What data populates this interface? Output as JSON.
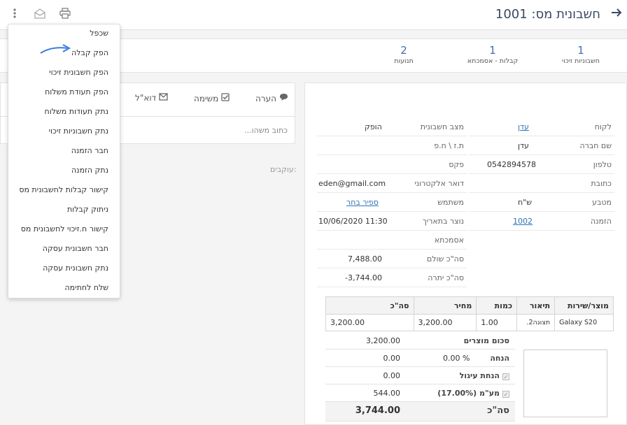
{
  "header": {
    "title": "חשבונית מס:",
    "number": "1001"
  },
  "stats": [
    {
      "count": "1",
      "label": "חשבוניות זיכוי"
    },
    {
      "count": "1",
      "label": "קבלות - אסמכתא"
    },
    {
      "count": "2",
      "label": "תנועות"
    }
  ],
  "activity": {
    "tabs": [
      "הערה",
      "משימה",
      "דוא\"ל"
    ],
    "placeholder": "כתוב משהו...",
    "followers_label": "עוקבים:"
  },
  "customer_fields": [
    {
      "label": "לקוח",
      "value": "עדן",
      "link": true
    },
    {
      "label": "שם חברה",
      "value": "עדן"
    },
    {
      "label": "טלפון",
      "value": "0542894578"
    },
    {
      "label": "כתובת",
      "value": ""
    },
    {
      "label": "מטבע",
      "value": "ש\"ח"
    },
    {
      "label": "הזמנה",
      "value": "1002",
      "link": true
    }
  ],
  "invoice_fields": [
    {
      "label": "מצב חשבונית",
      "value": "הופק"
    },
    {
      "label": "ת.ז \\ ח.פ",
      "value": ""
    },
    {
      "label": "פקס",
      "value": ""
    },
    {
      "label": "דואר אלקטרוני",
      "value": "eden@gmail.com"
    },
    {
      "label": "משתמש",
      "value": "ספיר בחר",
      "link": true
    },
    {
      "label": "נוצר בתאריך",
      "value": "10/06/2020 11:30"
    },
    {
      "label": "אסמכתא",
      "value": ""
    },
    {
      "label": "סה\"כ שולם",
      "value": "7,488.00"
    },
    {
      "label": "סה\"כ יתרה",
      "value": "-3,744.00"
    }
  ],
  "lines": {
    "headers": [
      "מוצר/שירות",
      "תיאור",
      "כמות",
      "מחיר",
      "סה\"כ"
    ],
    "rows": [
      [
        "Galaxy S20",
        "תצוגה2.",
        "1.00",
        "3,200.00",
        "3,200.00"
      ]
    ]
  },
  "summary": {
    "subtotal_label": "סכום מוצרים",
    "subtotal": "3,200.00",
    "discount_label": "הנחה",
    "discount_pct": "0.00",
    "discount_unit": "%",
    "discount": "0.00",
    "rounding_label": "הנחת עיגול",
    "rounding": "0.00",
    "vat_label": "מע\"מ (17.00%)",
    "vat": "544.00",
    "total_label": "סה\"כ",
    "total": "3,744.00"
  },
  "menu": [
    "שכפל",
    "הפק קבלה",
    "הפק חשבונית זיכוי",
    "הפק תעודת משלוח",
    "נתק תעודות משלוח",
    "נתק חשבוניות זיכוי",
    "חבר הזמנה",
    "נתק הזמנה",
    "קישור קבלות לחשבונית מס",
    "ניתוק קבלות",
    "קישור ח.זיכוי לחשבונית מס",
    "חבר חשבונית עסקה",
    "נתק חשבונית עסקה",
    "שלח לחתימה"
  ],
  "colors": {
    "accent": "#3e6fb4",
    "arrow": "#3b7be0",
    "title": "#3a4a63"
  },
  "icons": [
    "arrow-right-icon",
    "print-icon",
    "email-open-icon",
    "more-vertical-icon",
    "comment-icon",
    "check-square-icon",
    "envelope-icon"
  ]
}
